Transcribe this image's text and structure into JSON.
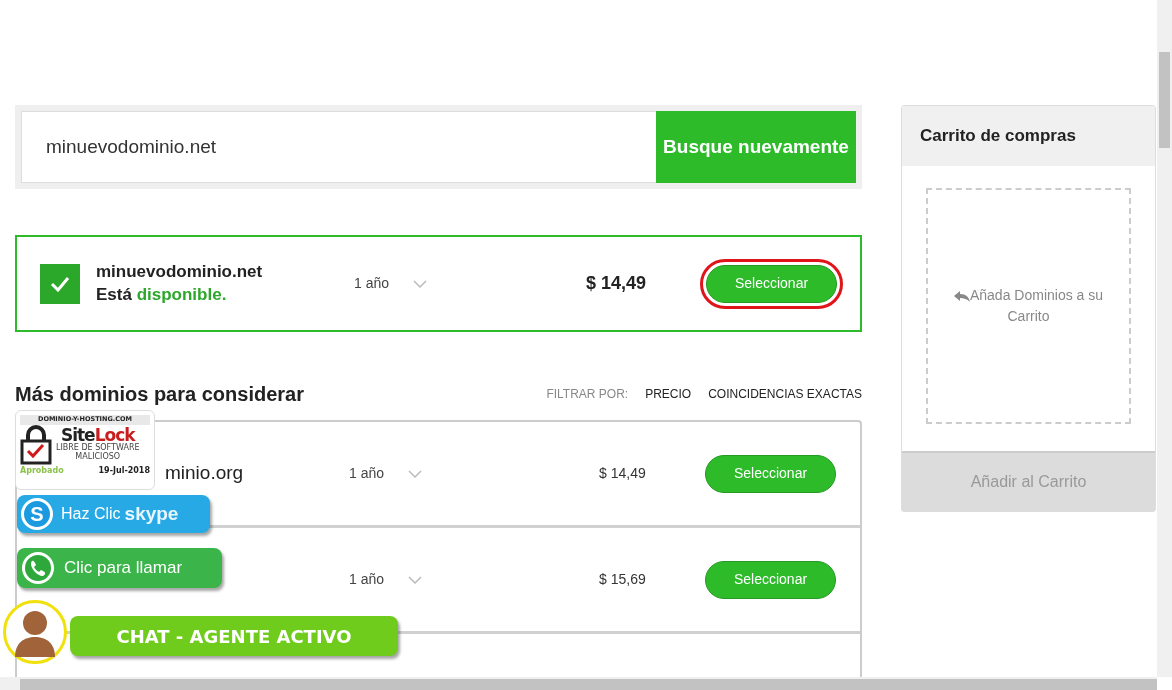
{
  "search": {
    "value": "minuevodominio.net",
    "button": "Busque nuevamente"
  },
  "result": {
    "checked": true,
    "domain": "minuevodominio.net",
    "status_prefix": "Está",
    "status_word": "disponible.",
    "term": "1 año",
    "price": "$ 14,49",
    "button": "Seleccionar",
    "highlighted": true
  },
  "more": {
    "title": "Más dominios para considerar",
    "filter_label": "FILTRAR POR:",
    "filters": [
      {
        "label": "PRECIO"
      },
      {
        "label": "COINCIDENCIAS EXACTAS"
      }
    ],
    "rows": [
      {
        "name": "minio.org",
        "term": "1 año",
        "price": "$ 14,49",
        "button": "Seleccionar"
      },
      {
        "term": "1 año",
        "price": "$ 15,69",
        "button": "Seleccionar"
      }
    ]
  },
  "cart": {
    "title": "Carrito de compras",
    "empty_hint": "Añada Dominios a su Carrito",
    "button": "Añadir al Carrito",
    "disabled": true
  },
  "sitelock": {
    "site": "DOMINIO-Y-HOSTING.COM",
    "brand_a": "Site",
    "brand_b": "Lock",
    "line1": "LIBRE DE SOFTWARE",
    "line2": "MALICIOSO",
    "approved": "Aprobado",
    "date": "19-Jul-2018"
  },
  "skype": {
    "icon": "S",
    "label": "Haz Clic",
    "brand": "skype"
  },
  "whatsapp": {
    "label": "Clic para llamar"
  },
  "chat": {
    "label": "CHAT - AGENTE ACTIVO"
  }
}
